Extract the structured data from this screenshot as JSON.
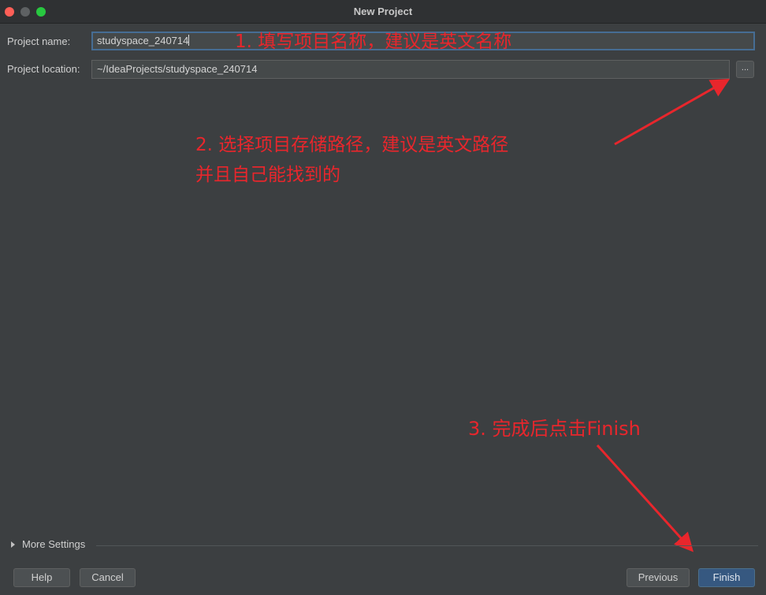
{
  "window": {
    "title": "New Project"
  },
  "form": {
    "name_label": "Project name:",
    "name_value": "studyspace_240714",
    "location_label": "Project location:",
    "location_value": "~/IdeaProjects/studyspace_240714",
    "browse_label": "..."
  },
  "more_settings": {
    "label": "More Settings"
  },
  "buttons": {
    "help": "Help",
    "cancel": "Cancel",
    "previous": "Previous",
    "finish": "Finish"
  },
  "annotations": {
    "step1": "1. 填写项目名称，建议是英文名称",
    "step2_line1": "2. 选择项目存储路径，建议是英文路径",
    "step2_line2": "并且自己能找到的",
    "step3": "3. 完成后点击Finish"
  },
  "colors": {
    "background": "#3c3f41",
    "annotation": "#e8262c",
    "primary_button": "#365880",
    "focus_border": "#466d94"
  }
}
